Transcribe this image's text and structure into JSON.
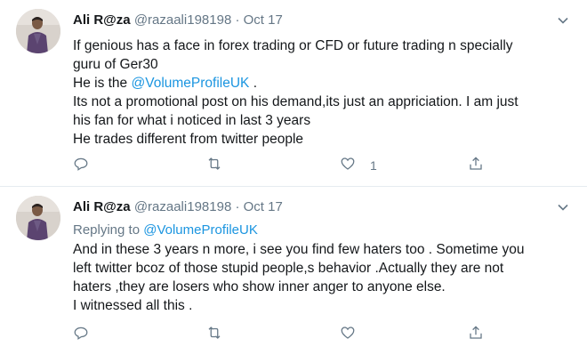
{
  "tweets": [
    {
      "name": "Ali R@za",
      "handle": "@razaali198198",
      "separator": "·",
      "date": "Oct 17",
      "lines": [
        "If genious has a face in forex trading or CFD or future trading n specially",
        "guru of Ger30",
        "He is the ",
        "Its not a promotional post on his demand,its just an appriciation. I am just",
        "his fan for what i noticed in last 3 years",
        "He trades different from twitter people"
      ],
      "mention": "@VolumeProfileUK",
      "mention_suffix": " .",
      "reply_count": "",
      "retweet_count": "",
      "like_count": "1"
    },
    {
      "name": "Ali R@za",
      "handle": "@razaali198198",
      "separator": "·",
      "date": "Oct 17",
      "replying_prefix": "Replying to ",
      "replying_to": "@VolumeProfileUK",
      "lines": [
        "And in these 3 years n more, i see you find few haters too . Sometime you",
        "left twitter bcoz of those stupid people,s behavior .Actually they are not",
        "haters ,they are losers who show inner anger to anyone else.",
        "I witnessed all this ."
      ],
      "reply_count": "",
      "retweet_count": "",
      "like_count": ""
    }
  ],
  "icons": {
    "reply": "reply-icon",
    "retweet": "retweet-icon",
    "like": "like-icon",
    "share": "share-icon",
    "caret": "chevron-down-icon"
  },
  "colors": {
    "link": "#1b95e0",
    "muted": "#657786",
    "text": "#14171a",
    "divider": "#e6ecf0"
  }
}
